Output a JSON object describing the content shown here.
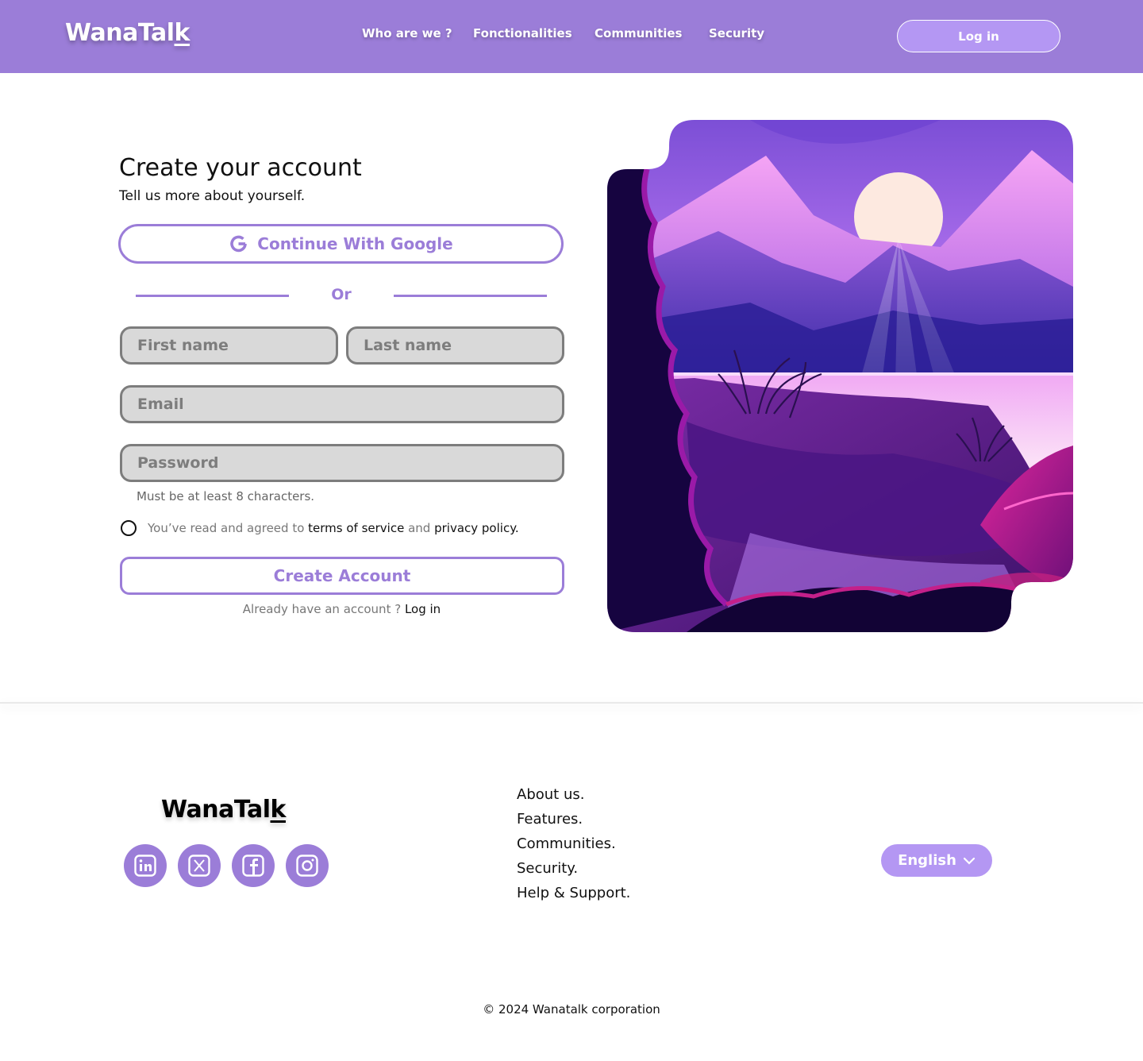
{
  "header": {
    "logo_main": "WanaTal",
    "logo_last": "k",
    "nav": [
      "Who are we ?",
      "Fonctionalities",
      "Communities",
      "Security"
    ],
    "login_label": "Log in"
  },
  "form": {
    "title": "Create your account",
    "subtitle": "Tell us more about yourself.",
    "google_label": "Continue With Google",
    "or_label": "Or",
    "first_name_placeholder": "First name",
    "last_name_placeholder": "Last name",
    "email_placeholder": "Email",
    "password_placeholder": "Password",
    "password_hint": "Must be at least 8 characters.",
    "terms_prefix": "You’ve read and agreed to ",
    "terms_link": "terms of service",
    "terms_and": " and ",
    "privacy_link": "privacy policy.",
    "create_label": "Create Account",
    "already_text": "Already have an account ? ",
    "already_link": "Log in"
  },
  "footer": {
    "logo_main": "WanaTal",
    "logo_last": "k",
    "social": [
      "linkedin-icon",
      "x-icon",
      "facebook-icon",
      "instagram-icon"
    ],
    "links": [
      "About us.",
      "Features.",
      "Communities.",
      "Security.",
      "Help & Support."
    ],
    "language": "English",
    "copyright": "© 2024 Wanatalk corporation"
  },
  "colors": {
    "brand": "#9b7dd8",
    "brand_light": "#b497f3",
    "input_bg": "#d9d9d9"
  }
}
